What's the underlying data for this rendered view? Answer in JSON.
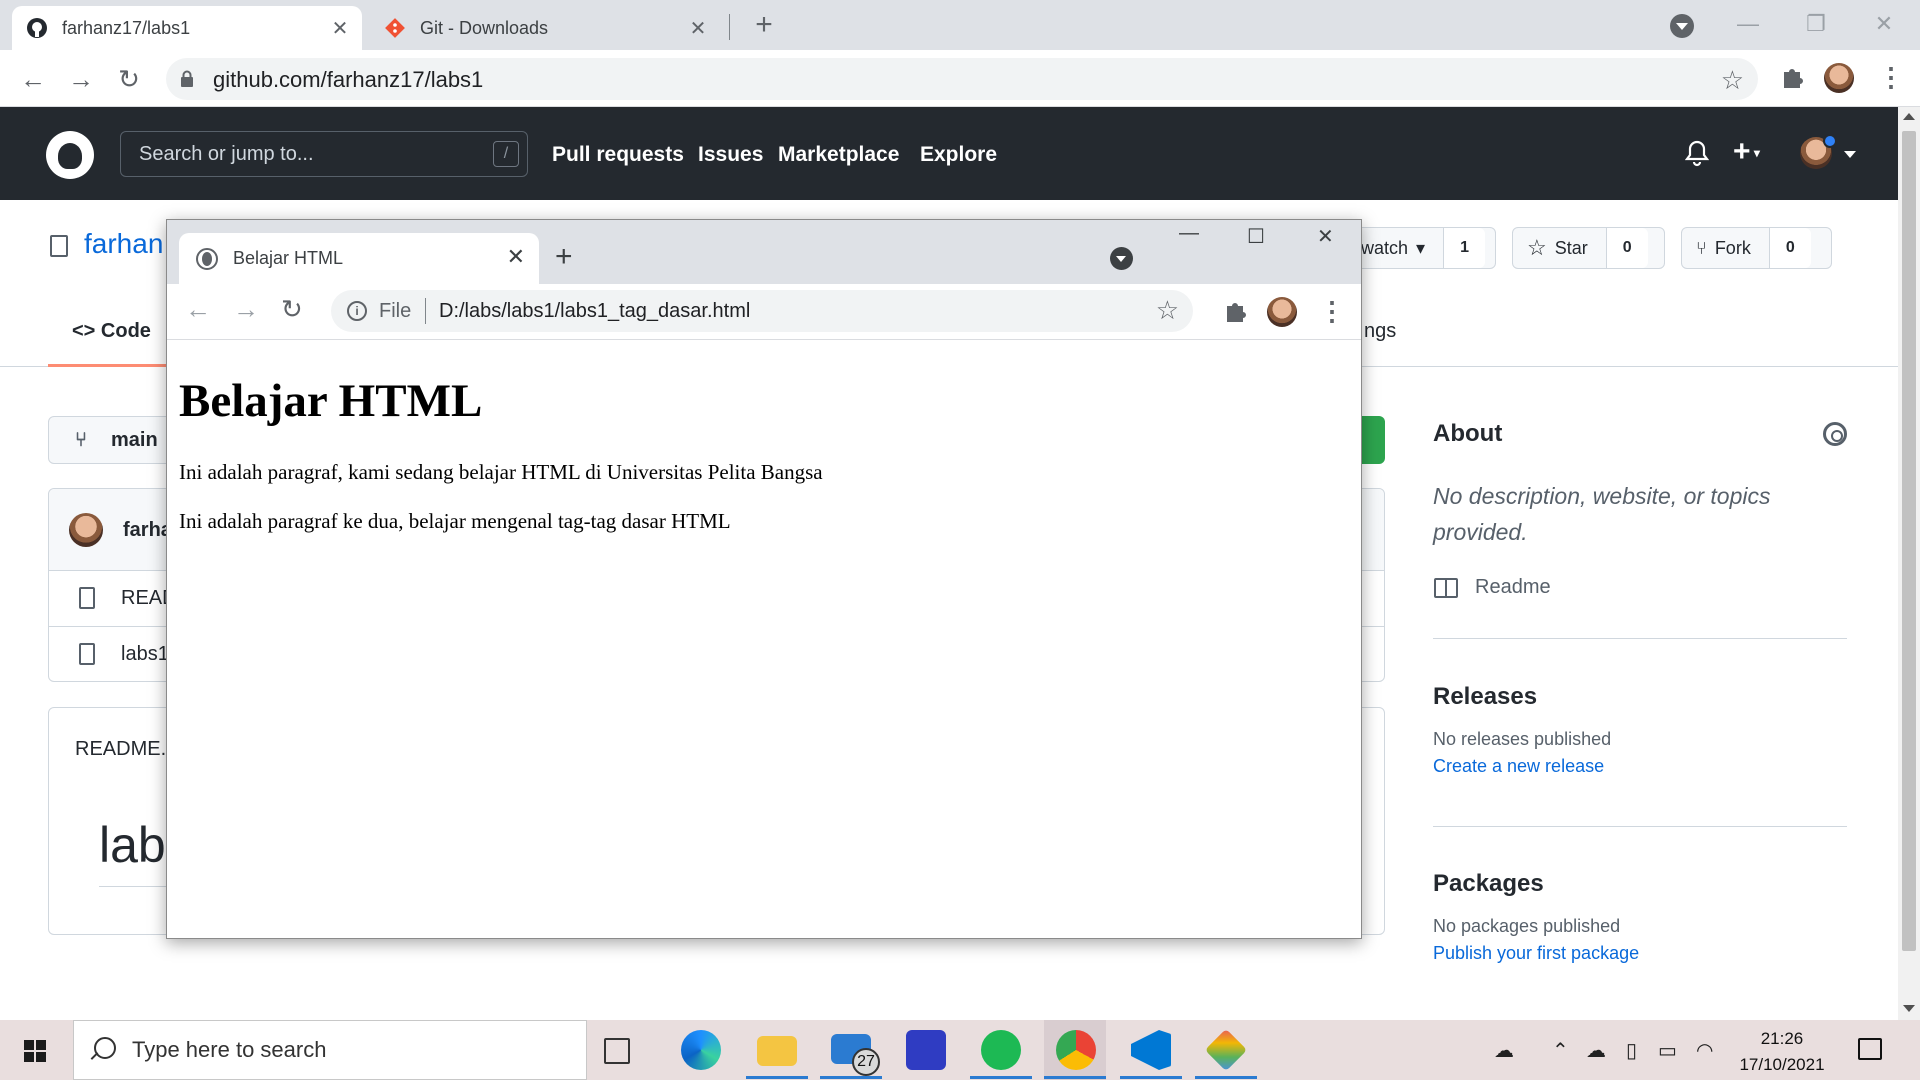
{
  "chrome": {
    "tabs": [
      {
        "title": "farhanz17/labs1"
      },
      {
        "title": "Git - Downloads"
      }
    ],
    "url": "github.com/farhanz17/labs1"
  },
  "github": {
    "search_placeholder": "Search or jump to...",
    "search_key": "/",
    "nav": [
      "Pull requests",
      "Issues",
      "Marketplace",
      "Explore"
    ],
    "repo_title_visible": "farhan",
    "watch_label": "watch",
    "watch_count": "1",
    "star_label": "Star",
    "star_count": "0",
    "fork_label": "Fork",
    "fork_count": "0",
    "tab_code": "Code",
    "tab_settings_partial": "ngs",
    "branch": "main",
    "commit_author_partial": "farha",
    "files": [
      "READ",
      "labs1"
    ],
    "readme_label": "README.r",
    "readme_heading_partial": "lab",
    "about": {
      "title": "About",
      "description": "No description, website, or topics provided.",
      "readme": "Readme"
    },
    "releases": {
      "title": "Releases",
      "none": "No releases published",
      "link": "Create a new release"
    },
    "packages": {
      "title": "Packages",
      "none": "No packages published",
      "link": "Publish your first package"
    }
  },
  "popup": {
    "tab_title": "Belajar HTML",
    "file_label": "File",
    "url": "D:/labs/labs1/labs1_tag_dasar.html",
    "heading": "Belajar HTML",
    "paragraphs": [
      "Ini adalah paragraf, kami sedang belajar HTML di Universitas Pelita Bangsa",
      "Ini adalah paragraf ke dua, belajar mengenal tag-tag dasar HTML"
    ]
  },
  "taskbar": {
    "search_placeholder": "Type here to search",
    "mail_badge": "27",
    "time": "21:26",
    "date": "17/10/2021"
  },
  "colors": {
    "github_header": "#24292f",
    "link": "#0969da",
    "code_button": "#2da44e",
    "active_tab_underline": "#fd8c73"
  }
}
